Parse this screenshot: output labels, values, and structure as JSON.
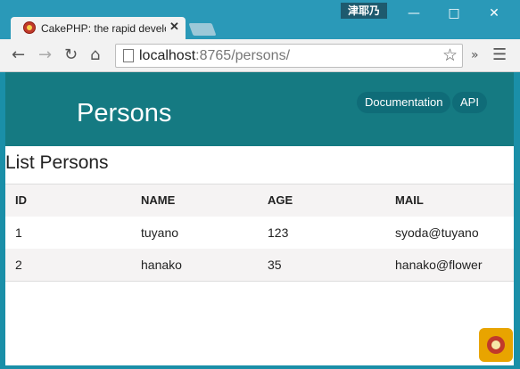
{
  "window": {
    "user": "津耶乃",
    "tab_title": "CakePHP: the rapid development",
    "url_host": "localhost",
    "url_rest": ":8765/persons/"
  },
  "site": {
    "brand": "Persons",
    "nav": [
      "Documentation",
      "API"
    ]
  },
  "main": {
    "heading": "List Persons",
    "table": {
      "columns": [
        "ID",
        "NAME",
        "AGE",
        "MAIL"
      ],
      "rows": [
        [
          "1",
          "tuyano",
          "123",
          "syoda@tuyano"
        ],
        [
          "2",
          "hanako",
          "35",
          "hanako@flower"
        ]
      ]
    }
  },
  "colors": {
    "header": "#157a82",
    "nav_pill": "#0f6c78"
  }
}
